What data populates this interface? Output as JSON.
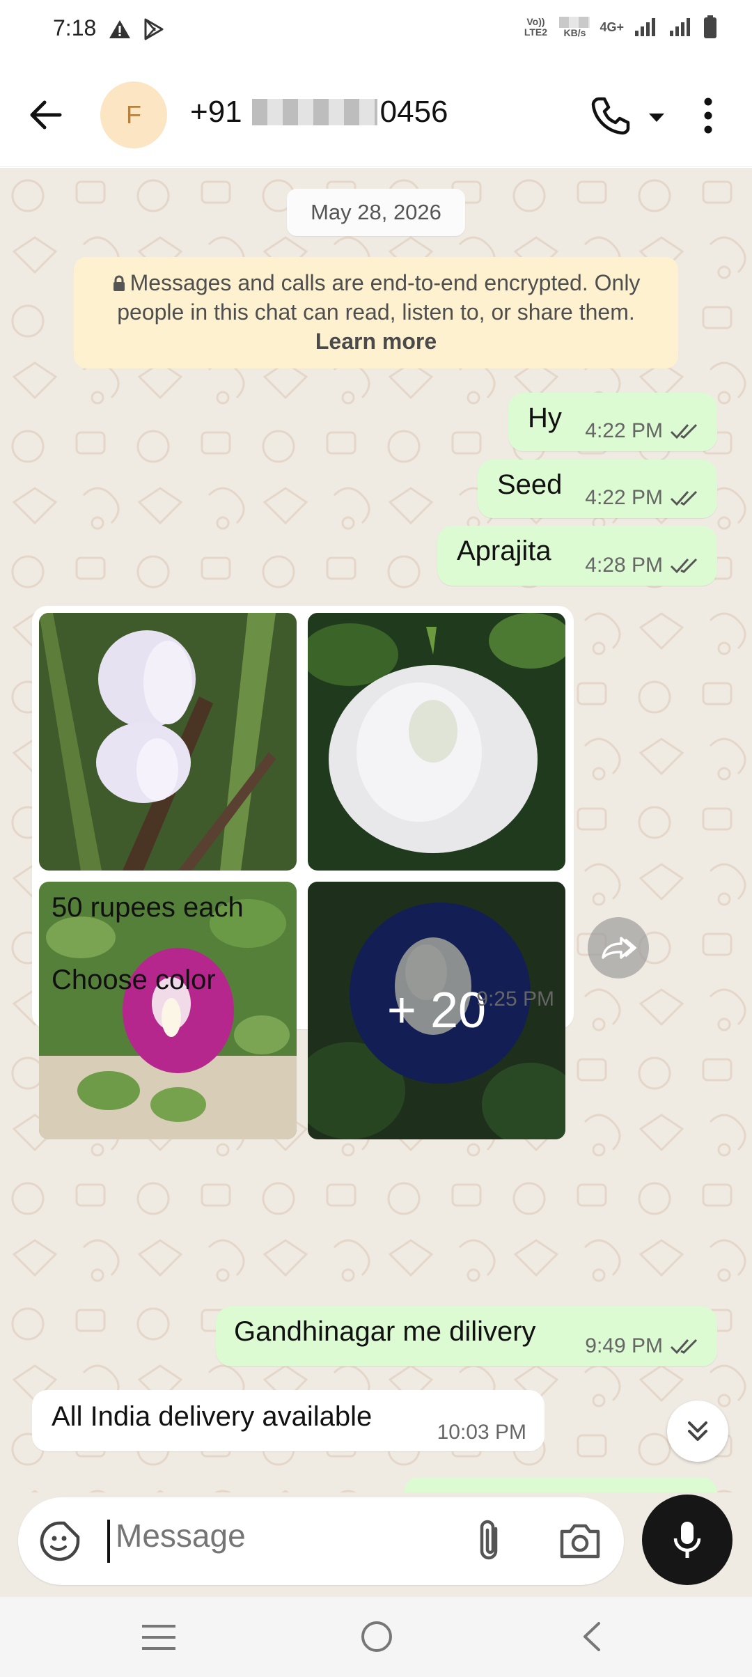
{
  "status_bar": {
    "time": "7:18",
    "volte": "Vo)) LTE2",
    "speed_unit": "KB/s",
    "network": "4G+"
  },
  "header": {
    "avatar_letter": "F",
    "phone_prefix": "+91",
    "phone_suffix": "0456"
  },
  "chat": {
    "date": "May 28, 2026",
    "encryption_notice": "Messages and calls are end-to-end encrypted. Only people in this chat can read, listen to, or share them.",
    "learn_more": "Learn more",
    "messages": [
      {
        "text": "Hy",
        "time": "4:22 PM"
      },
      {
        "text": "Seed",
        "time": "4:22 PM"
      },
      {
        "text": "Aprajita",
        "time": "4:28 PM"
      }
    ],
    "photo_message": {
      "more_count": "+ 20",
      "caption_line1": "50 rupees each",
      "caption_line2": "Choose color",
      "time": "9:25 PM"
    },
    "reply_1": {
      "text": "Gandhinagar me dilivery",
      "time": "9:49 PM"
    },
    "incoming_2": {
      "text": "All India delivery available",
      "time": "10:03 PM"
    }
  },
  "composer": {
    "placeholder": "Message"
  },
  "colors": {
    "outgoing_bubble": "#dcfbd2",
    "chat_background": "#efeae2",
    "notice_background": "#fdf1cf",
    "mic_button": "#161616"
  }
}
